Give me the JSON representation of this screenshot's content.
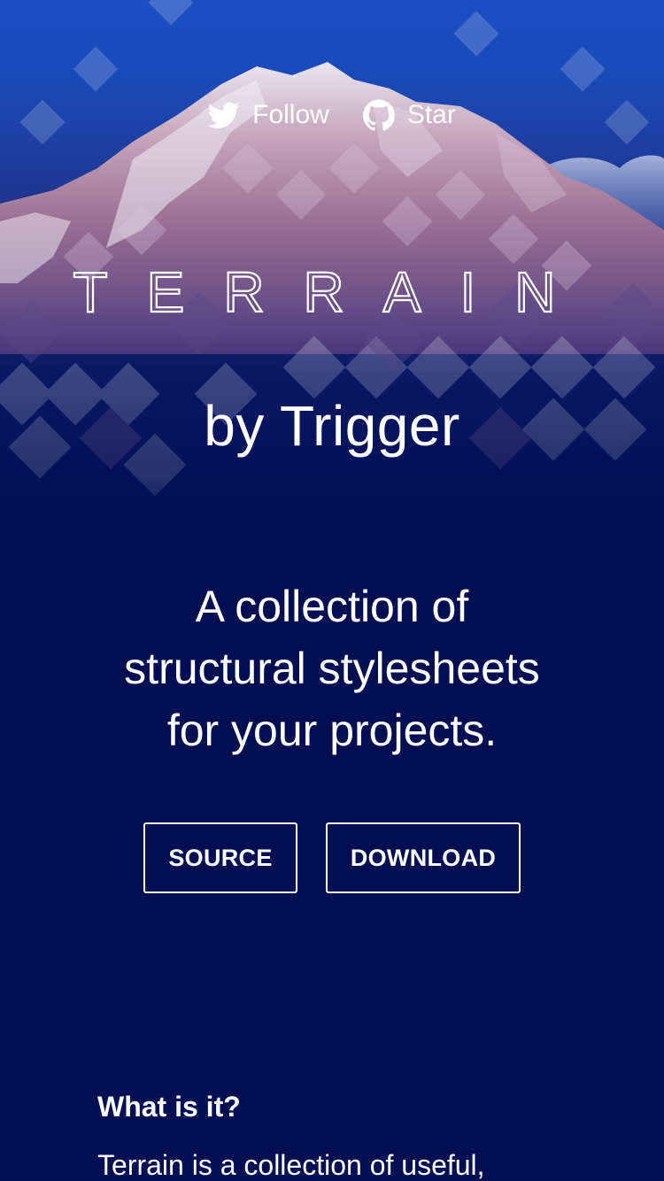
{
  "colors": {
    "background": "#000f52",
    "hero_top": "#1c4fc4",
    "text": "#ffffff"
  },
  "social": {
    "follow": {
      "icon": "twitter-icon",
      "label": "Follow"
    },
    "star": {
      "icon": "github-icon",
      "label": "Star"
    }
  },
  "hero": {
    "logo_text": "TERRAIN",
    "byline": "by Trigger"
  },
  "tagline": {
    "lines": [
      "A collection of",
      "structural stylesheets",
      "for your projects."
    ]
  },
  "buttons": {
    "source_label": "SOURCE",
    "download_label": "DOWNLOAD"
  },
  "about": {
    "heading": "What is it?",
    "text": "Terrain is a collection of useful,"
  }
}
